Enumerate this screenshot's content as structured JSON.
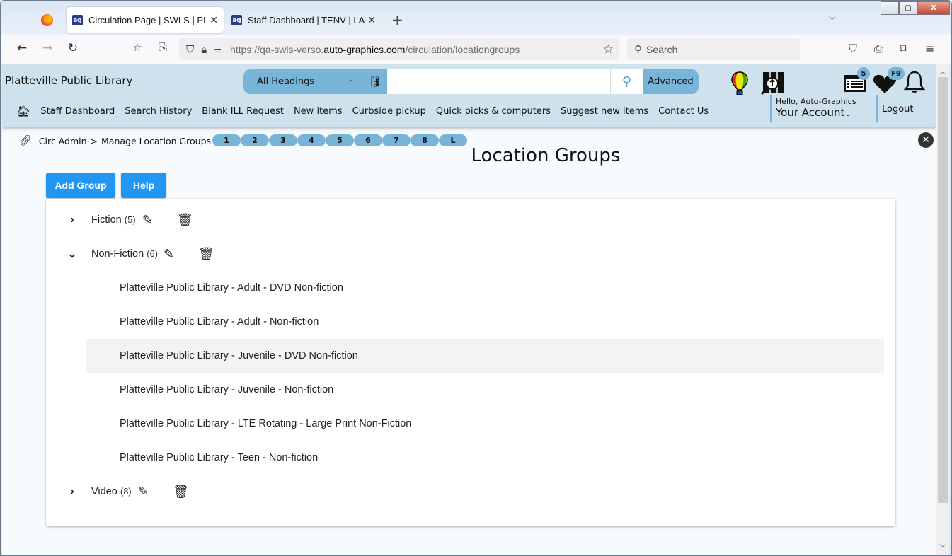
{
  "browser": {
    "tabs": [
      {
        "label": "Circulation Page | SWLS | PLATT",
        "favicon": "ag-logo-icon",
        "active": true
      },
      {
        "label": "Staff Dashboard | TENV | LAFOL",
        "favicon": "ag-logo-icon",
        "active": false
      }
    ],
    "new_tab": "+",
    "url_prefix": "https://qa-swls-verso.",
    "url_domain": "auto-graphics.com",
    "url_path": "/circulation/locationgroups",
    "search_placeholder": "Search",
    "window_controls": {
      "minimize": "—",
      "maximize": "▢",
      "close": "X"
    }
  },
  "header": {
    "library_name": "Platteville Public Library",
    "search": {
      "scope": "All Headings",
      "query": "",
      "advanced_label": "Advanced"
    },
    "icons": {
      "lists_badge": "5",
      "favorites_badge": "F9"
    },
    "menu": [
      "Staff Dashboard",
      "Search History",
      "Blank ILL Request",
      "New items",
      "Curbside pickup",
      "Quick picks & computers",
      "Suggest new items",
      "Contact Us"
    ],
    "account": {
      "greeting": "Hello, Auto-Graphics",
      "label": "Your Account"
    },
    "logout_label": "Logout"
  },
  "breadcrumb": {
    "parent": "Circ Admin",
    "separator": ">",
    "current": "Manage Location Groups"
  },
  "quick_pills": [
    "1",
    "2",
    "3",
    "4",
    "5",
    "6",
    "7",
    "8",
    "L"
  ],
  "page": {
    "title": "Location Groups",
    "add_group_label": "Add Group",
    "help_label": "Help"
  },
  "groups": [
    {
      "name": "Fiction",
      "count": "(5)",
      "expanded": false,
      "children": []
    },
    {
      "name": "Non-Fiction",
      "count": "(6)",
      "expanded": true,
      "children": [
        "Platteville Public Library - Adult - DVD Non-fiction",
        "Platteville Public Library - Adult - Non-fiction",
        "Platteville Public Library - Juvenile - DVD Non-fiction",
        "Platteville Public Library - Juvenile - Non-fiction",
        "Platteville Public Library - LTE Rotating - Large Print Non-Fiction",
        "Platteville Public Library - Teen - Non-fiction"
      ]
    },
    {
      "name": "Video",
      "count": "(8)",
      "expanded": false,
      "children": []
    }
  ],
  "colors": {
    "header_bg": "#cfe1ec",
    "accent_blue": "#78b4d8",
    "primary_button": "#2196f3",
    "hover_row": "#f3f3f3"
  }
}
